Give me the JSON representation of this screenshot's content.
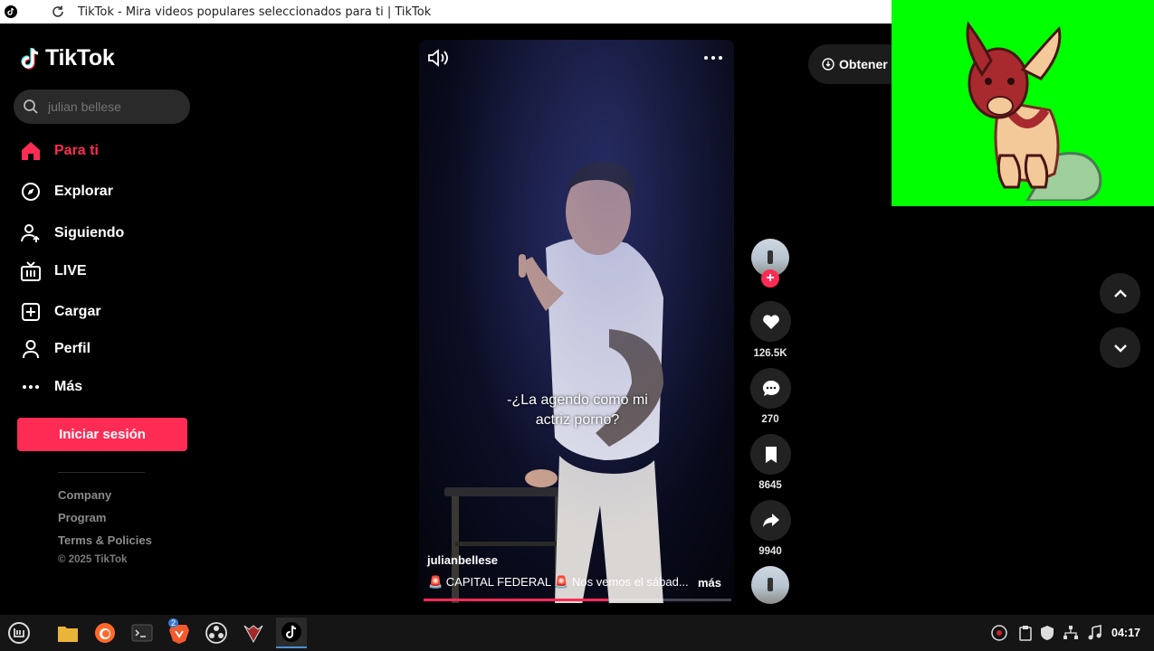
{
  "window": {
    "title": "TikTok - Mira videos populares seleccionados para ti | TikTok"
  },
  "sidebar": {
    "logo_text": "TikTok",
    "search": {
      "value": "",
      "placeholder": "julian bellese"
    },
    "nav": [
      {
        "label": "Para ti",
        "icon": "home-icon",
        "active": true
      },
      {
        "label": "Explorar",
        "icon": "compass-icon"
      },
      {
        "label": "Siguiendo",
        "icon": "following-icon"
      },
      {
        "label": "LIVE",
        "icon": "live-tv-icon"
      },
      {
        "label": "Cargar",
        "icon": "upload-plus-icon"
      },
      {
        "label": "Perfil",
        "icon": "profile-icon"
      },
      {
        "label": "Más",
        "icon": "more-dots-icon"
      }
    ],
    "login_label": "Iniciar sesión",
    "footer_links": [
      "Company",
      "Program",
      "Terms & Policies"
    ],
    "copyright": "© 2025 TikTok"
  },
  "video": {
    "subtitle_line1": "-¿La agendo como mi",
    "subtitle_line2": "actriz porno?",
    "author": "julianbellese",
    "caption": "🚨 CAPITAL FEDERAL 🚨 Nos vemos el sábad...",
    "more_label": "más",
    "progress": 0.6
  },
  "actions": {
    "likes": "126.5K",
    "comments": "270",
    "saves": "8645",
    "shares": "9940"
  },
  "get_app_label": "Obtener l",
  "taskbar": {
    "clock": "04:17",
    "badge_count": "2"
  },
  "colors": {
    "accent": "#fe2c55",
    "background": "#000000",
    "overlay_green": "#00ff00"
  }
}
